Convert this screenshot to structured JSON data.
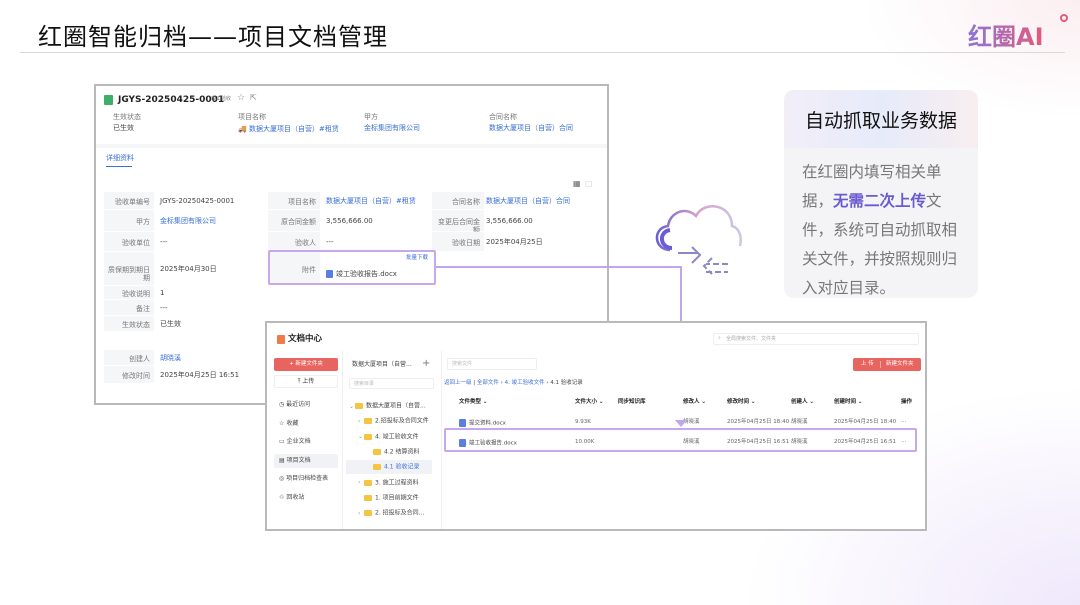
{
  "slide": {
    "title": "红圈智能归档——项目文档管理",
    "logo": "红圈AI"
  },
  "callout": {
    "heading": "自动抓取业务数据",
    "text_before": "在红圈内填写相关单据，",
    "highlight": "无需二次上传",
    "text_after": "文件，系统可自动抓取相关文件，并按照规则归入对应目录。"
  },
  "record": {
    "id": "JGYS-20250425-0001",
    "tag": "竣工验收",
    "summary": [
      {
        "label": "生效状态",
        "value": "已生效"
      },
      {
        "label": "项目名称",
        "value": "数据大厦项目（自营）#租赁"
      },
      {
        "label": "甲方",
        "value": "金标集团有限公司"
      },
      {
        "label": "合同名称",
        "value": "数据大厦项目（自营）合同"
      }
    ],
    "tab": "详细资料",
    "fields": {
      "f1": {
        "label": "验收单编号",
        "value": "JGYS-20250425-0001"
      },
      "f2": {
        "label": "项目名称",
        "value": "数据大厦项目（自营）#租赁"
      },
      "f3": {
        "label": "合同名称",
        "value": "数据大厦项目（自营）合同"
      },
      "f4": {
        "label": "甲方",
        "value": "金标集团有限公司"
      },
      "f5": {
        "label": "原合同金额",
        "value": "3,556,666.00"
      },
      "f6": {
        "label": "变更后合同金额",
        "value": "3,556,666.00"
      },
      "f7": {
        "label": "验收单位",
        "value": "---"
      },
      "f8": {
        "label": "验收人",
        "value": "---"
      },
      "f9": {
        "label": "验收日期",
        "value": "2025年04月25日"
      },
      "f10": {
        "label": "质保期到期日期",
        "value": "2025年04月30日"
      },
      "f11": {
        "label": "附件",
        "value": "竣工验收报告.docx",
        "action": "批量下载"
      },
      "f12": {
        "label": "验收说明",
        "value": "1"
      },
      "f13": {
        "label": "备注",
        "value": "---"
      },
      "f14": {
        "label": "生效状态",
        "value": "已生效"
      },
      "f15": {
        "label": "创建人",
        "value": "胡晓溪"
      },
      "f16": {
        "label": "修改时间",
        "value": "2025年04月25日 16:51"
      }
    }
  },
  "docs": {
    "title": "文档中心",
    "global_search": "全局搜索文件、文件夹",
    "new_folder": "+ 新建文件夹",
    "upload": "上传",
    "nav": [
      "最近访问",
      "收藏",
      "企业文档",
      "项目文档",
      "项目归档检查表",
      "回收站"
    ],
    "project": "数据大厦项目（自营...",
    "dir_search": "搜索目录",
    "file_search": "搜索文件",
    "tree": [
      "数据大厦项目（自营...",
      "2.招投标及合同文件",
      "4. 竣工验收文件",
      "4.2 结算资料",
      "4.1 验收记录",
      "3. 施工过程资料",
      "1. 项目前期文件",
      "2. 招投标及合同..."
    ],
    "breadcrumb": {
      "back": "返回上一级",
      "all": "全部文件",
      "p1": "4. 竣工验收文件",
      "p2": "4.1 验收记录"
    },
    "btn_upload": "上 传",
    "btn_new": "新建文件夹",
    "columns": [
      "文件类型 ⌄",
      "文件大小 ⌄",
      "同步知识库",
      "修改人 ⌄",
      "修改时间 ⌄",
      "创建人 ⌄",
      "创建时间 ⌄",
      "操作"
    ],
    "rows": [
      [
        "提交资料.docx",
        "9.93K",
        "",
        "胡晓溪",
        "2025年04月25日 18:40",
        "胡晓溪",
        "2025年04月25日 18:40",
        "···"
      ],
      [
        "竣工验收报告.docx",
        "10.00K",
        "",
        "胡晓溪",
        "2025年04月25日 16:51",
        "胡晓溪",
        "2025年04月25日 16:51",
        "···"
      ]
    ]
  },
  "colors": {
    "accent_red": "#e8645f",
    "link": "#3a6fd8",
    "highlight": "#c8a8ec",
    "callout_em": "#6b5bd2"
  }
}
